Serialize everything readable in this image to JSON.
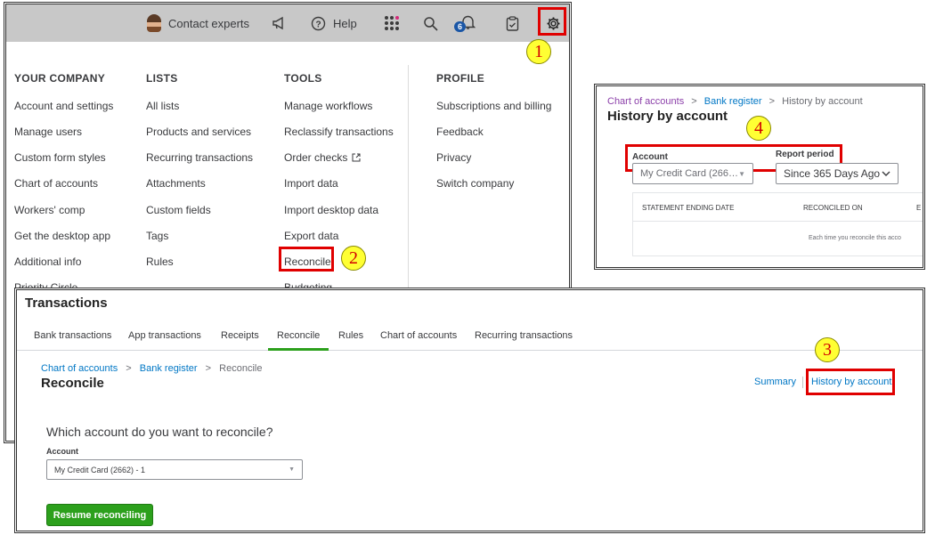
{
  "topbar": {
    "contact": "Contact experts",
    "help": "Help",
    "notification_count": "6"
  },
  "menu": {
    "columns": [
      {
        "heading": "YOUR COMPANY",
        "items": [
          "Account and settings",
          "Manage users",
          "Custom form styles",
          "Chart of accounts",
          "Workers' comp",
          "Get the desktop app",
          "Additional info",
          "Priority Circle"
        ]
      },
      {
        "heading": "LISTS",
        "items": [
          "All lists",
          "Products and services",
          "Recurring transactions",
          "Attachments",
          "Custom fields",
          "Tags",
          "Rules"
        ]
      },
      {
        "heading": "TOOLS",
        "items": [
          "Manage workflows",
          "Reclassify transactions",
          "Order checks",
          "Import data",
          "Import desktop data",
          "Export data",
          "Reconcile",
          "Budgeting"
        ]
      },
      {
        "heading": "PROFILE",
        "items": [
          "Subscriptions and billing",
          "Feedback",
          "Privacy",
          "Switch company"
        ]
      }
    ]
  },
  "markers": [
    "1",
    "2",
    "3",
    "4"
  ],
  "history": {
    "breadcrumb": [
      "Chart of accounts",
      ">",
      "Bank register",
      ">",
      "History by account"
    ],
    "title": "History by account",
    "account_label": "Account",
    "account_value": "My Credit Card (266…",
    "period_label": "Report period",
    "period_value": "Since 365 Days Ago",
    "columns": [
      "STATEMENT ENDING DATE",
      "RECONCILED ON",
      "E"
    ],
    "empty_text": "Each time you reconcile this acco"
  },
  "reconcile": {
    "section_title": "Transactions",
    "tabs": [
      "Bank transactions",
      "App transactions",
      "Receipts",
      "Reconcile",
      "Rules",
      "Chart of accounts",
      "Recurring transactions"
    ],
    "breadcrumb": [
      "Chart of accounts",
      ">",
      "Bank register",
      ">",
      "Reconcile"
    ],
    "title": "Reconcile",
    "summary_link": "Summary",
    "history_link": "History by account",
    "question": "Which account do you want to reconcile?",
    "account_label": "Account",
    "account_value": "My Credit Card (2662) - 1",
    "resume_button": "Resume reconciling"
  },
  "colors": {
    "accent_green": "#2ca01c",
    "link_blue": "#0077c5",
    "highlight_red": "#e00000",
    "marker_yellow": "#ffff33"
  }
}
